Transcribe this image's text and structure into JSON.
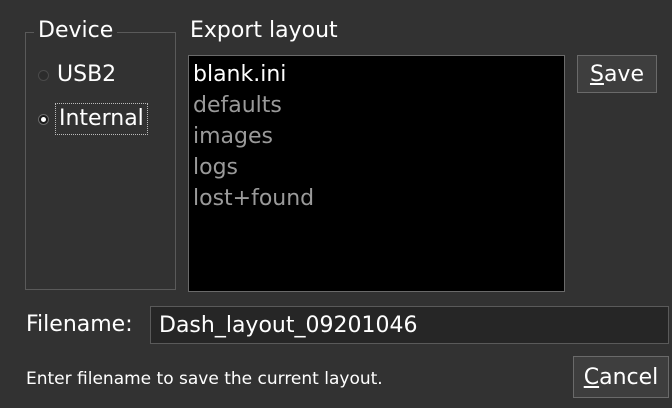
{
  "device_group": {
    "title": "Device",
    "options": [
      {
        "label": "USB2",
        "selected": false
      },
      {
        "label": "Internal",
        "selected": true
      }
    ]
  },
  "export_group": {
    "title": "Export layout",
    "items": [
      "blank.ini",
      "defaults",
      "images",
      "logs",
      "lost+found"
    ],
    "selected_index": 0
  },
  "buttons": {
    "save": {
      "mnemonic": "S",
      "rest": "ave"
    },
    "cancel": {
      "mnemonic": "C",
      "rest": "ancel"
    }
  },
  "filename": {
    "label": "Filename:",
    "value": "Dash_layout_09201046"
  },
  "hint": "Enter filename to save the current layout."
}
